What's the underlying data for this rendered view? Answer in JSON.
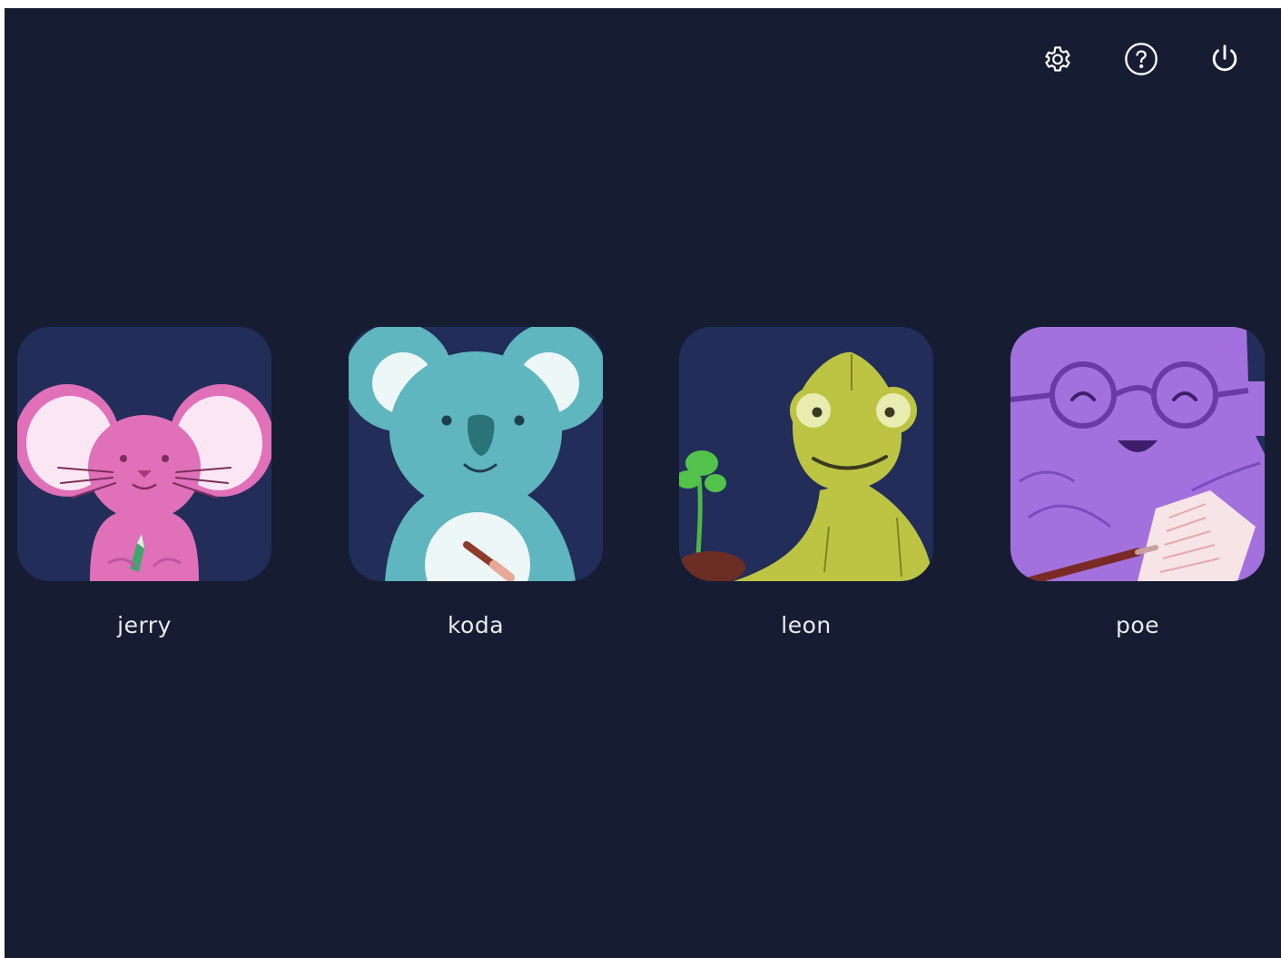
{
  "toolbar": {
    "settings_icon": "gear-icon",
    "help_icon": "question-circle-icon",
    "power_icon": "power-icon"
  },
  "users": [
    {
      "name": "jerry",
      "avatar": "pink-mouse",
      "color": "#e070b8"
    },
    {
      "name": "koda",
      "avatar": "teal-koala",
      "color": "#5fb6bf"
    },
    {
      "name": "leon",
      "avatar": "green-chameleon",
      "color": "#bdc443"
    },
    {
      "name": "poe",
      "avatar": "purple-octopus",
      "color": "#a371de"
    }
  ],
  "colors": {
    "background": "#161d32",
    "avatar_bg": "#222d5a",
    "text": "#e8ebf2"
  }
}
